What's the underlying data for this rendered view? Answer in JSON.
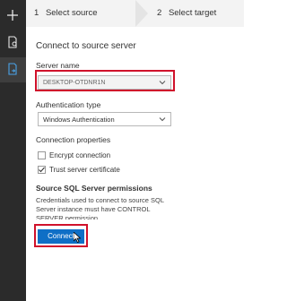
{
  "wizard": {
    "steps": [
      {
        "number": "1",
        "label": "Select source"
      },
      {
        "number": "2",
        "label": "Select target"
      }
    ]
  },
  "panel": {
    "title": "Connect to source server"
  },
  "server_name": {
    "label": "Server name",
    "value": "DESKTOP-OTDNR1N"
  },
  "auth": {
    "label": "Authentication type",
    "value": "Windows Authentication"
  },
  "connection_props": {
    "label": "Connection properties",
    "encrypt": {
      "label": "Encrypt connection",
      "checked": false
    },
    "trust_cert": {
      "label": "Trust server certificate",
      "checked": true
    }
  },
  "permissions": {
    "title": "Source SQL Server permissions",
    "text": "Credentials used to connect to source SQL Server instance must have CONTROL SERVER permission."
  },
  "connect_button": {
    "label": "Connect"
  },
  "left_rail": {
    "icons": [
      "plus-icon",
      "document-icon",
      "assessment-icon"
    ]
  },
  "colors": {
    "rail": "#2b2b2b",
    "accent": "#0f6fc6",
    "highlight": "#d0112b"
  }
}
